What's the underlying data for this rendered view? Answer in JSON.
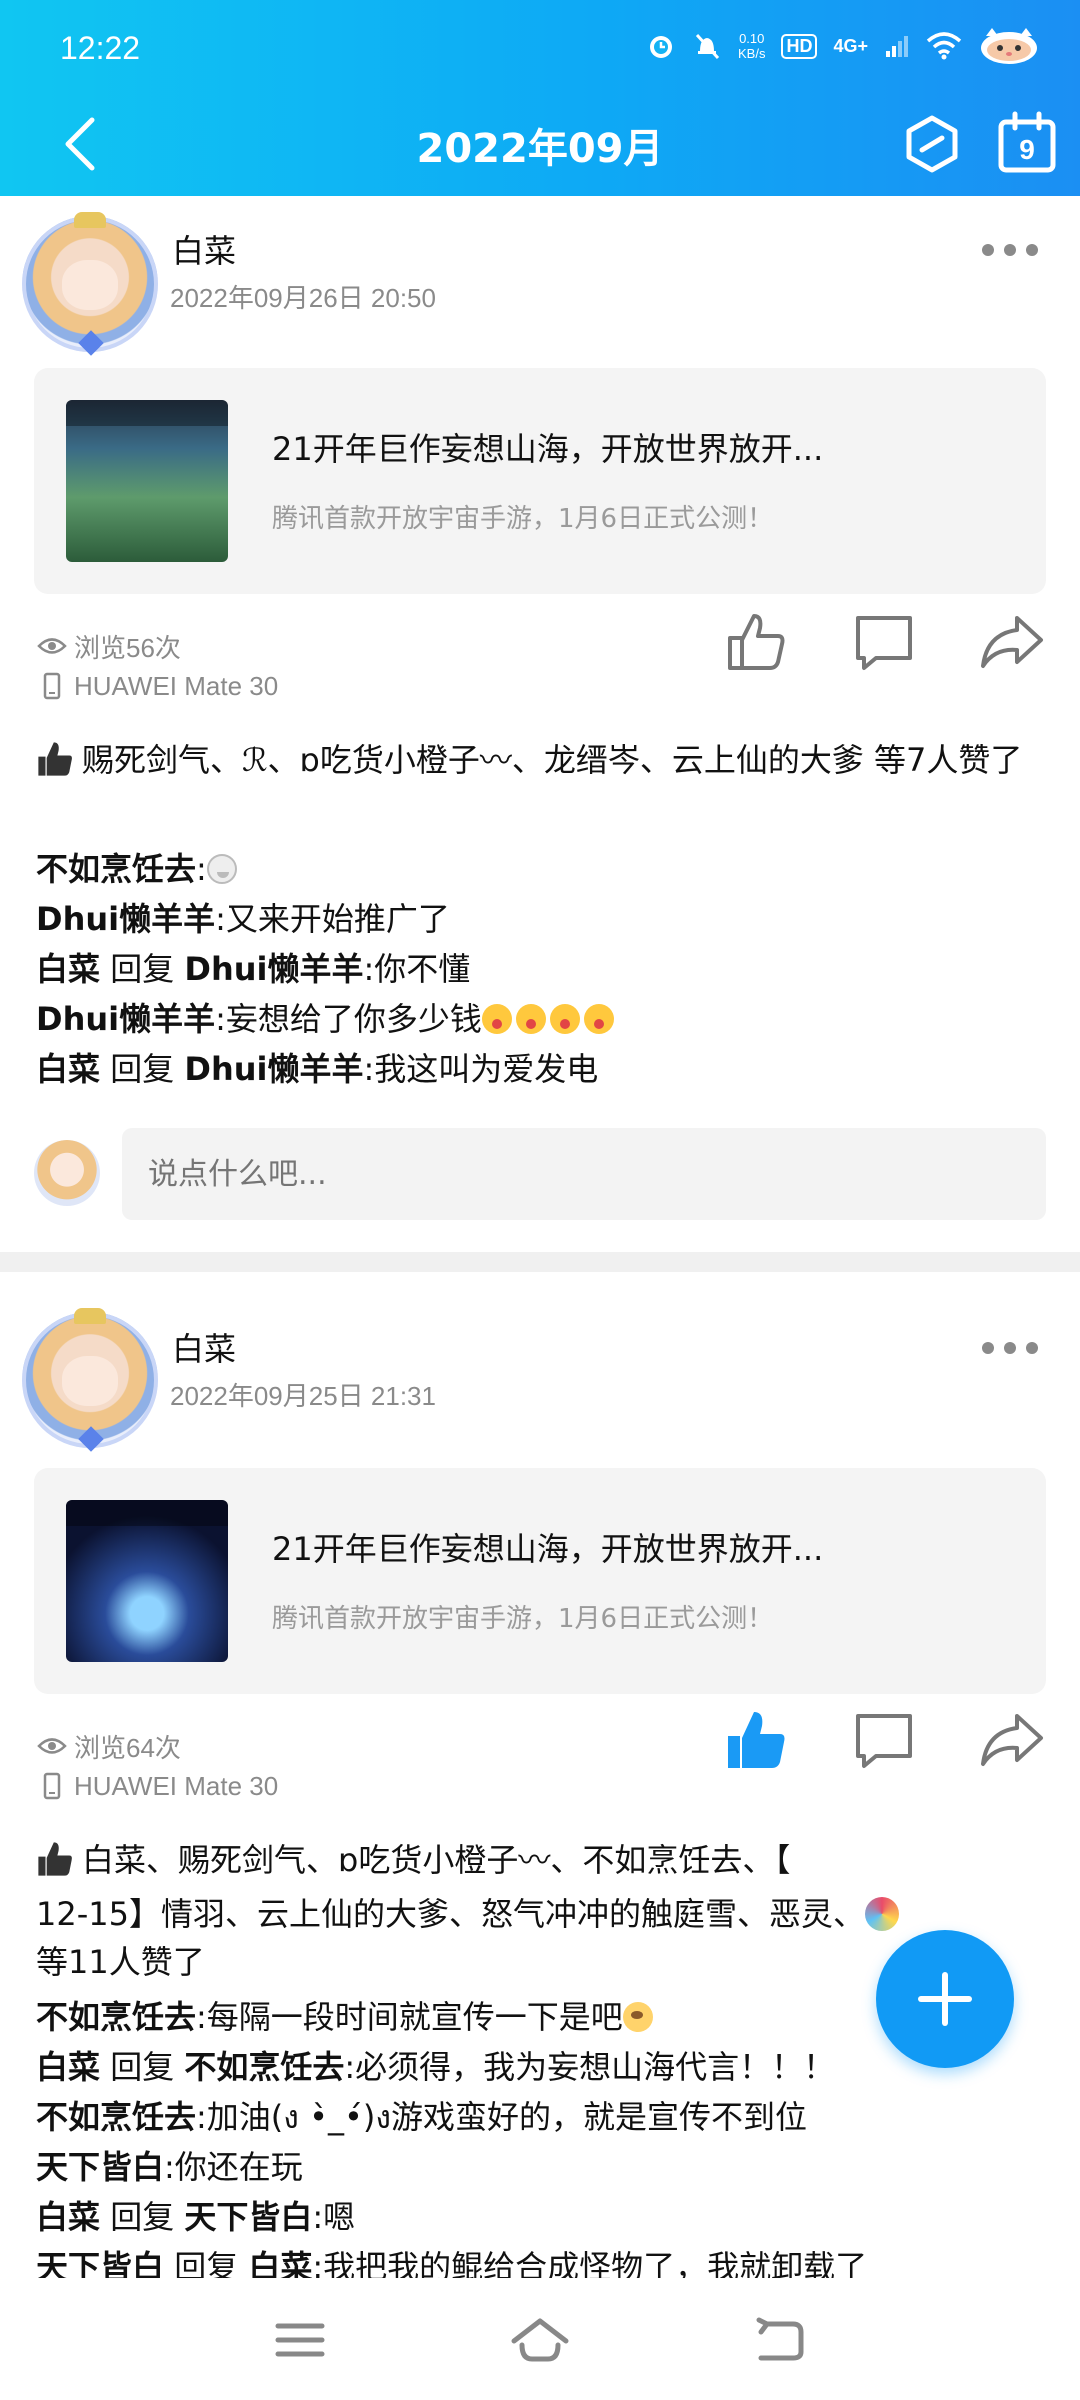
{
  "status_bar": {
    "time": "12:22",
    "net_speed_value": "0.10",
    "net_speed_unit": "KB/s",
    "hd": "HD",
    "network": "4G+"
  },
  "nav": {
    "title": "2022年09月",
    "calendar_day": "9"
  },
  "posts": [
    {
      "author": "白菜",
      "time": "2022年09月26日 20:50",
      "share_title": "21开年巨作妄想山海，开放世界放开...",
      "share_desc": "腾讯首款开放宇宙手游，1月6日正式公测！",
      "views": "浏览56次",
      "device": "HUAWEI Mate 30",
      "liked": false,
      "likes_text": "赐死剑气、ℛ、ɒ吃货小橙子〰、龙缙岑、云上仙的大爹 等7人赞了",
      "comments": [
        {
          "name": "不如烹饪去",
          "reply_word": "",
          "target": "",
          "text": ""
        },
        {
          "name": "Dhui懒羊羊",
          "reply_word": "",
          "target": "",
          "text": "又来开始推广了"
        },
        {
          "name": "白菜",
          "reply_word": "回复",
          "target": "Dhui懒羊羊",
          "text": "你不懂"
        },
        {
          "name": "Dhui懒羊羊",
          "reply_word": "",
          "target": "",
          "text": "妄想给了你多少钱"
        },
        {
          "name": "白菜",
          "reply_word": "回复",
          "target": "Dhui懒羊羊",
          "text": "我这叫为爱发电"
        }
      ],
      "input_placeholder": "说点什么吧..."
    },
    {
      "author": "白菜",
      "time": "2022年09月25日 21:31",
      "share_title": "21开年巨作妄想山海，开放世界放开...",
      "share_desc": "腾讯首款开放宇宙手游，1月6日正式公测！",
      "views": "浏览64次",
      "device": "HUAWEI Mate 30",
      "liked": true,
      "likes_text_line1": "白菜、赐死剑气、ɒ吃货小橙子〰、不如烹饪去、【",
      "likes_text_line2": "12-15】情羽、云上仙的大爹、怒气冲冲的触庭雪、恶灵、",
      "likes_text_line3": "等11人赞了",
      "comments": [
        {
          "name": "不如烹饪去",
          "reply_word": "",
          "target": "",
          "text": "每隔一段时间就宣传一下是吧"
        },
        {
          "name": "白菜",
          "reply_word": "回复",
          "target": "不如烹饪去",
          "text": "必须得，我为妄想山海代言！！！"
        },
        {
          "name": "不如烹饪去",
          "reply_word": "",
          "target": "",
          "text": "加油(ง •̀_•́)ง游戏蛮好的，就是宣传不到位"
        },
        {
          "name": "天下皆白",
          "reply_word": "",
          "target": "",
          "text": "你还在玩"
        },
        {
          "name": "白菜",
          "reply_word": "回复",
          "target": "天下皆白",
          "text": "嗯"
        },
        {
          "name": "天下皆白",
          "reply_word": "回复",
          "target": "白菜",
          "text": "我把我的鲲给合成怪物了，我就卸载了"
        }
      ]
    }
  ],
  "colors": {
    "header_start": "#10c6f2",
    "header_end": "#1b8ff3",
    "accent": "#119af5"
  }
}
